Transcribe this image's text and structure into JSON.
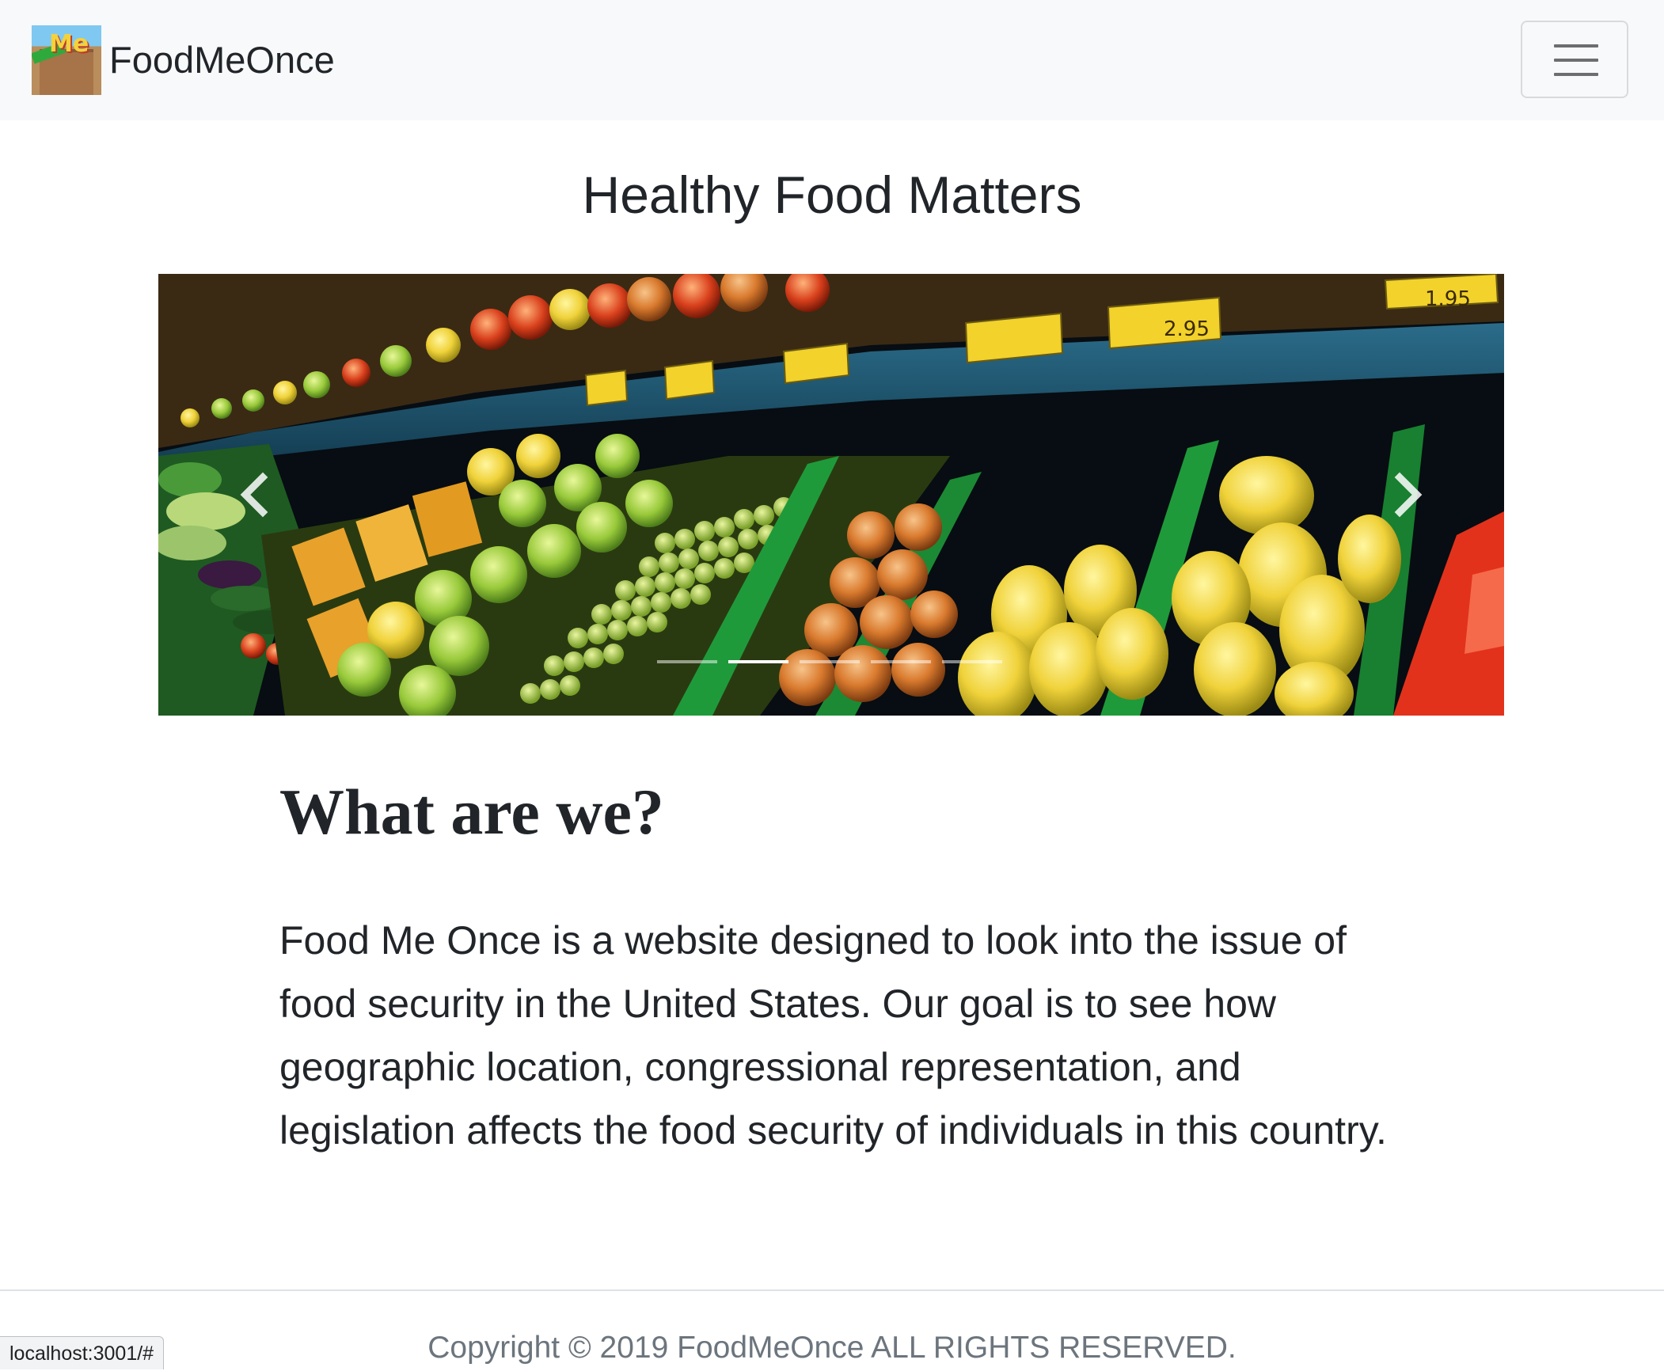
{
  "navbar": {
    "brand_text": "FoodMeOnce",
    "logo_icon": "foodmeonce-logo",
    "toggler_icon": "hamburger-menu-icon"
  },
  "hero": {
    "title": "Healthy Food Matters"
  },
  "carousel": {
    "slide_count": 5,
    "active_index": 1,
    "prev_icon": "chevron-left-icon",
    "next_icon": "chevron-right-icon"
  },
  "about": {
    "heading": "What are we?",
    "body": "Food Me Once is a website designed to look into the issue of food security in the United States. Our goal is to see how geographic location, congressional representation, and legislation affects the food security of individuals in this country."
  },
  "footer": {
    "copyright": "Copyright © 2019 FoodMeOnce ALL RIGHTS RESERVED."
  },
  "status_bar": {
    "url": "localhost:3001/#"
  },
  "colors": {
    "navbar_bg": "#f8f9fa",
    "text": "#212529",
    "muted_text": "#6c757d"
  }
}
